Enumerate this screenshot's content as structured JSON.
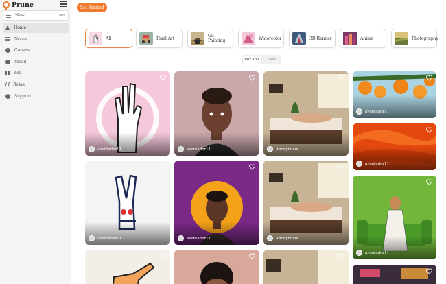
{
  "app": {
    "name": "Prune"
  },
  "sidebar": {
    "new_label": "New",
    "new_shortcut": "⌘N",
    "items": [
      {
        "label": "Home",
        "icon": "home-icon",
        "active": true
      },
      {
        "label": "Notes",
        "icon": "notes-icon"
      },
      {
        "label": "Canvas",
        "icon": "canvas-icon"
      },
      {
        "label": "Mood",
        "icon": "mood-icon"
      },
      {
        "label": "Zen",
        "icon": "zen-icon"
      },
      {
        "label": "Relax",
        "icon": "relax-icon"
      }
    ],
    "support_label": "Support"
  },
  "header": {
    "cta_label": "Get Started"
  },
  "styles": [
    {
      "label": "All",
      "selected": true,
      "color": "#f7d9e6"
    },
    {
      "label": "Pixel Art",
      "color": "#9bb3a0"
    },
    {
      "label": "Oil Painting",
      "color": "#a88a5c"
    },
    {
      "label": "Watercolor",
      "color": "#e88ab0"
    },
    {
      "label": "3D Render",
      "color": "#3f5a7a"
    },
    {
      "label": "Anime",
      "color": "#c0557a"
    },
    {
      "label": "Photography",
      "color": "#b49a4a"
    }
  ],
  "tabs": [
    {
      "label": "For You",
      "active": true
    },
    {
      "label": "Liked",
      "active": false
    }
  ],
  "feed": [
    {
      "author": "aventador11",
      "subject": "hand-three-fingers"
    },
    {
      "author": "aventador11",
      "subject": "portrait-man"
    },
    {
      "author": "Anonymous",
      "subject": "spa-massage"
    },
    {
      "author": "aventador11",
      "subject": "oranges"
    },
    {
      "author": "aventador11",
      "subject": "orange-waves"
    },
    {
      "author": "aventador11",
      "subject": "hand-peace"
    },
    {
      "author": "aventador11",
      "subject": "boy-portrait"
    },
    {
      "author": "Anonymous",
      "subject": "spa-massage"
    },
    {
      "author": "aventador11",
      "subject": "woman-on-sofa"
    }
  ],
  "colors": {
    "accent": "#f07b2f"
  }
}
